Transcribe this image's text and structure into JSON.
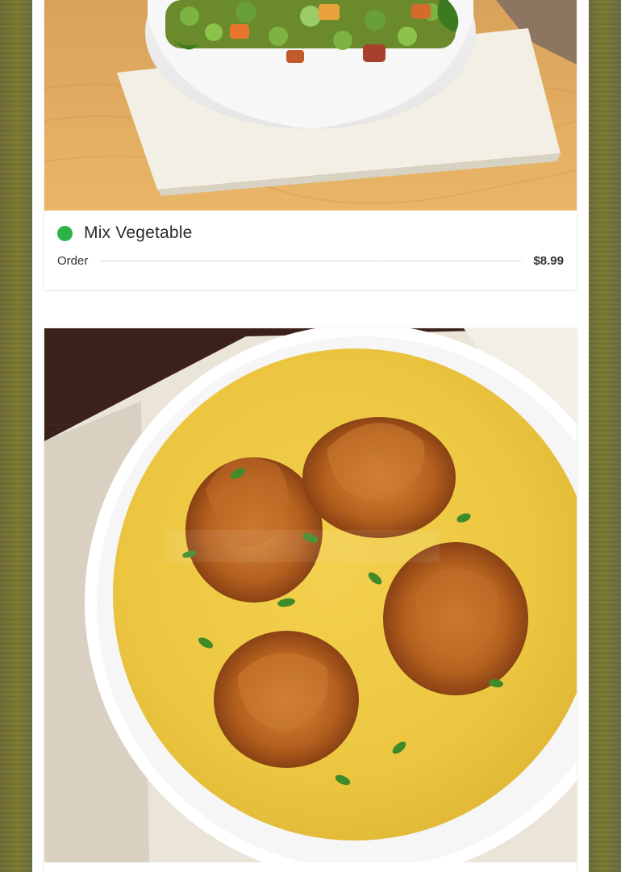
{
  "menu_items": [
    {
      "name": "Mix Vegetable",
      "order_label": "Order",
      "price": "$8.99",
      "veg_indicator_color": "#2cb34a",
      "image_icon": "mix-vegetable-bowl-photo"
    },
    {
      "image_icon": "pakora-kadhi-bowl-photo"
    }
  ],
  "colors": {
    "veg_green": "#2cb34a",
    "card_bg": "#ffffff"
  }
}
